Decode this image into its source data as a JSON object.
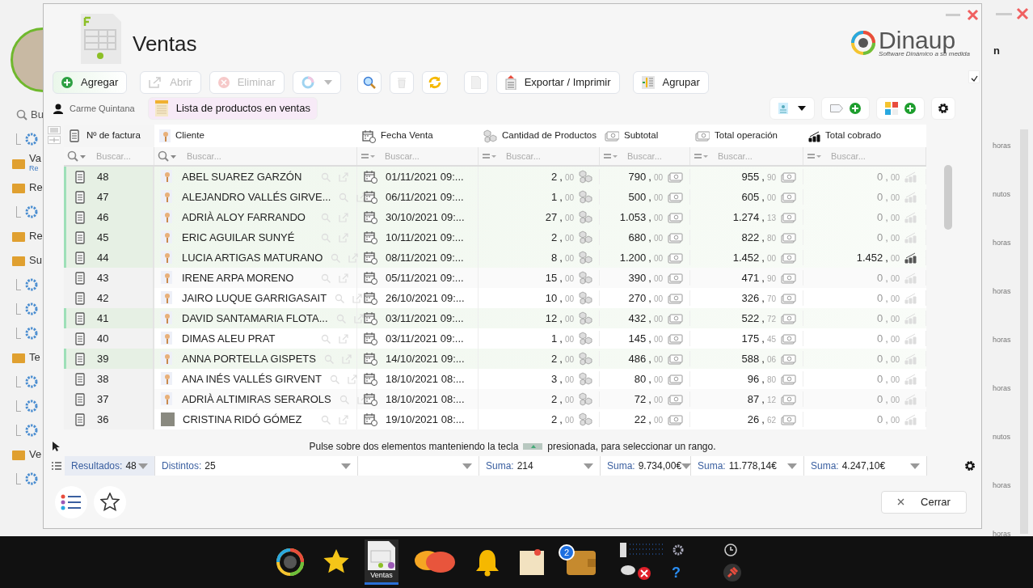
{
  "background_app": {
    "sidebar": [
      {
        "kind": "search",
        "label": "Bu"
      },
      {
        "kind": "subitem"
      },
      {
        "kind": "item",
        "label": "Va",
        "sublabel": "Re"
      },
      {
        "kind": "item",
        "label": "Re"
      },
      {
        "kind": "subitem"
      },
      {
        "kind": "item",
        "label": "Re"
      },
      {
        "kind": "item",
        "label": "Su"
      },
      {
        "kind": "subitem"
      },
      {
        "kind": "subitem"
      },
      {
        "kind": "subitem"
      },
      {
        "kind": "item",
        "label": "Te"
      },
      {
        "kind": "subitem"
      },
      {
        "kind": "subitem"
      },
      {
        "kind": "subitem"
      },
      {
        "kind": "item",
        "label": "Ve"
      },
      {
        "kind": "subitem"
      }
    ],
    "header_fragment": "n",
    "list_fragments": [
      "horas",
      "nutos",
      "horas",
      "horas",
      "horas",
      "horas",
      "nutos",
      "horas",
      "horas"
    ]
  },
  "window": {
    "title": "Ventas",
    "brand": "Dinaup",
    "brand_tagline": "Software Dinámico a su medida"
  },
  "toolbar": [
    {
      "kind": "add",
      "label": "Agregar",
      "disabled": false
    },
    {
      "kind": "open",
      "label": "Abrir",
      "disabled": true
    },
    {
      "kind": "delete",
      "label": "Eliminar",
      "disabled": true
    },
    {
      "kind": "color"
    },
    {
      "kind": "search"
    },
    {
      "kind": "trash"
    },
    {
      "kind": "refresh"
    },
    {
      "kind": "doc"
    },
    {
      "kind": "export",
      "label": "Exportar / Imprimir",
      "disabled": false
    },
    {
      "kind": "group",
      "label": "Agrupar",
      "disabled": false
    }
  ],
  "user": "Carme Quintana",
  "view_tab": {
    "label": "Lista de productos en ventas",
    "selected": true
  },
  "table": {
    "columns": [
      {
        "label": "Nº de factura",
        "kind": "search",
        "placeholder": "Buscar..."
      },
      {
        "label": "Cliente",
        "kind": "search",
        "placeholder": "Buscar..."
      },
      {
        "label": "Fecha Venta",
        "kind": "equals",
        "placeholder": "Buscar..."
      },
      {
        "label": "Cantidad de Productos",
        "kind": "equals",
        "placeholder": "Buscar..."
      },
      {
        "label": "Subtotal",
        "kind": "equals",
        "placeholder": "Buscar..."
      },
      {
        "label": "Total operación",
        "kind": "equals",
        "placeholder": "Buscar..."
      },
      {
        "label": "Total cobrado",
        "kind": "equals",
        "placeholder": "Buscar..."
      }
    ],
    "rows": [
      {
        "invoice": "48",
        "client": "ABEL SUAREZ GARZÓN",
        "kind": "generic",
        "date": "01/11/2021 09:...",
        "quantity": "2,00",
        "subtotal": "790,00",
        "total": "955,90",
        "collected": "0,00",
        "paid": false,
        "highlighted": true
      },
      {
        "invoice": "47",
        "client": "ALEJANDRO VALLÉS GIRVE...",
        "kind": "generic",
        "date": "06/11/2021 09:...",
        "quantity": "1,00",
        "subtotal": "500,00",
        "total": "605,00",
        "collected": "0,00",
        "paid": false,
        "highlighted": true
      },
      {
        "invoice": "46",
        "client": "ADRIÀ ALOY FARRANDO",
        "kind": "generic",
        "date": "30/10/2021 09:...",
        "quantity": "27,00",
        "subtotal": "1.053,00",
        "total": "1.274,13",
        "collected": "0,00",
        "paid": false,
        "highlighted": true
      },
      {
        "invoice": "45",
        "client": "ERIC AGUILAR SUNYÉ",
        "kind": "generic",
        "date": "10/11/2021 09:...",
        "quantity": "2,00",
        "subtotal": "680,00",
        "total": "822,80",
        "collected": "0,00",
        "paid": false,
        "highlighted": true
      },
      {
        "invoice": "44",
        "client": "LUCIA ARTIGAS MATURANO",
        "kind": "generic",
        "date": "08/11/2021 09:...",
        "quantity": "8,00",
        "subtotal": "1.200,00",
        "total": "1.452,00",
        "collected": "1.452,00",
        "paid": true,
        "highlighted": true
      },
      {
        "invoice": "43",
        "client": "IRENE ARPA MORENO",
        "kind": "generic",
        "date": "05/11/2021 09:...",
        "quantity": "15,00",
        "subtotal": "390,00",
        "total": "471,90",
        "collected": "0,00",
        "paid": false,
        "highlighted": false
      },
      {
        "invoice": "42",
        "client": "JAIRO LUQUE GARRIGASAIT",
        "kind": "generic",
        "date": "26/10/2021 09:...",
        "quantity": "10,00",
        "subtotal": "270,00",
        "total": "326,70",
        "collected": "0,00",
        "paid": false,
        "highlighted": false
      },
      {
        "invoice": "41",
        "client": "DAVID SANTAMARIA FLOTA...",
        "kind": "generic",
        "date": "03/11/2021 09:...",
        "quantity": "12,00",
        "subtotal": "432,00",
        "total": "522,72",
        "collected": "0,00",
        "paid": false,
        "highlighted": true
      },
      {
        "invoice": "40",
        "client": "DIMAS ALEU PRAT",
        "kind": "generic",
        "date": "03/11/2021 09:...",
        "quantity": "1,00",
        "subtotal": "145,00",
        "total": "175,45",
        "collected": "0,00",
        "paid": false,
        "highlighted": false
      },
      {
        "invoice": "39",
        "client": "ANNA PORTELLA GISPETS",
        "kind": "generic",
        "date": "14/10/2021 09:...",
        "quantity": "2,00",
        "subtotal": "486,00",
        "total": "588,06",
        "collected": "0,00",
        "paid": false,
        "highlighted": true
      },
      {
        "invoice": "38",
        "client": "ANA INÉS VALLÉS GIRVENT",
        "kind": "generic",
        "date": "18/10/2021 08:...",
        "quantity": "3,00",
        "subtotal": "80,00",
        "total": "96,80",
        "collected": "0,00",
        "paid": false,
        "highlighted": false
      },
      {
        "invoice": "37",
        "client": "ADRIÀ ALTIMIRAS SERAROLS",
        "kind": "generic",
        "date": "18/10/2021 08:...",
        "quantity": "2,00",
        "subtotal": "72,00",
        "total": "87,12",
        "collected": "0,00",
        "paid": false,
        "highlighted": false
      },
      {
        "invoice": "36",
        "client": "CRISTINA RIDÓ GÓMEZ",
        "kind": "photo",
        "date": "19/10/2021 08:...",
        "quantity": "2,00",
        "subtotal": "22,00",
        "total": "26,62",
        "collected": "0,00",
        "paid": false,
        "highlighted": false
      }
    ]
  },
  "hint": {
    "before": "Pulse sobre dos elementos manteniendo la tecla",
    "after": "presionada, para seleccionar un rango."
  },
  "footer": [
    {
      "label": "Resultados:",
      "value": "48"
    },
    {
      "label": "Distintos:",
      "value": "25"
    },
    {
      "kind": "blank"
    },
    {
      "label": "Suma:",
      "value": "214"
    },
    {
      "label": "Suma:",
      "value": "9.734,00€"
    },
    {
      "label": "Suma:",
      "value": "11.778,14€"
    },
    {
      "label": "Suma:",
      "value": "4.247,10€"
    }
  ],
  "close_button": "Cerrar",
  "taskbar": {
    "help": "?",
    "apps": [
      {
        "kind": "logo",
        "selected": false
      },
      {
        "kind": "star",
        "selected": false
      },
      {
        "kind": "sales",
        "label": "Ventas",
        "selected": true
      },
      {
        "kind": "chat",
        "selected": false
      },
      {
        "kind": "bell",
        "selected": false
      },
      {
        "kind": "note",
        "selected": false
      },
      {
        "kind": "wallet",
        "badge": "2",
        "selected": false
      }
    ]
  }
}
